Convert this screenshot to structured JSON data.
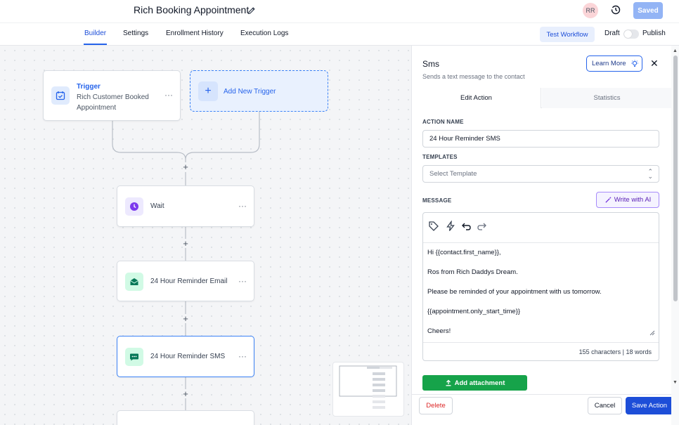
{
  "header": {
    "title": "Rich Booking Appointment",
    "avatar_initials": "RR",
    "saved_label": "Saved"
  },
  "nav": {
    "tabs": [
      {
        "label": "Builder",
        "active": true
      },
      {
        "label": "Settings",
        "active": false
      },
      {
        "label": "Enrollment History",
        "active": false
      },
      {
        "label": "Execution Logs",
        "active": false
      }
    ],
    "test_workflow": "Test Workflow",
    "draft_label": "Draft",
    "publish_label": "Publish"
  },
  "canvas": {
    "trigger": {
      "title": "Trigger",
      "subtitle": "Rich Customer Booked Appointment",
      "menu": "···"
    },
    "add_trigger_label": "Add New Trigger",
    "steps": [
      {
        "label": "Wait",
        "icon": "clock-icon",
        "color": "#7c3aed",
        "bg": "#ede9fe"
      },
      {
        "label": "24 Hour Reminder Email",
        "icon": "email-icon",
        "color": "#047857",
        "bg": "#d1fae5"
      },
      {
        "label": "24 Hour Reminder SMS",
        "icon": "sms-icon",
        "color": "#047857",
        "bg": "#d1fae5",
        "selected": true
      }
    ],
    "plus": "+",
    "menu": "···"
  },
  "panel": {
    "title": "Sms",
    "subtitle": "Sends a text message to the contact",
    "learn_more": "Learn More",
    "close": "✕",
    "tabs": {
      "edit": "Edit Action",
      "stats": "Statistics"
    },
    "action_name_label": "ACTION NAME",
    "action_name_value": "24 Hour Reminder SMS",
    "templates_label": "TEMPLATES",
    "templates_placeholder": "Select Template",
    "message_label": "MESSAGE",
    "write_ai": "Write with AI",
    "message_lines": [
      "Hi {{contact.first_name}},",
      "Ros from Rich Daddys Dream.",
      "Please be reminded of your appointment with us tomorrow.",
      "{{appointment.only_start_time}}",
      "Cheers!"
    ],
    "char_count": "155 characters | 18 words",
    "add_attachment": "Add attachment",
    "delete": "Delete",
    "cancel": "Cancel",
    "save_action": "Save Action"
  },
  "colors": {
    "accent": "#2563eb",
    "save": "#1d4ed8",
    "attach": "#16a34a",
    "delete": "#dc2626"
  }
}
